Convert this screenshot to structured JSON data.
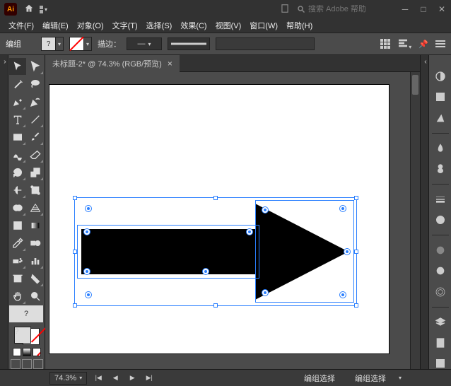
{
  "app": {
    "logo_text": "Ai"
  },
  "search": {
    "placeholder": "搜索 Adobe 帮助"
  },
  "menus": {
    "file": "文件(F)",
    "edit": "编辑(E)",
    "object": "对象(O)",
    "type": "文字(T)",
    "select": "选择(S)",
    "effect": "效果(C)",
    "view": "视图(V)",
    "window": "窗口(W)",
    "help": "帮助(H)"
  },
  "control": {
    "mode_label": "编组",
    "fill_q": "?",
    "stroke_label": "描边：",
    "stroke_dash": "—"
  },
  "tab": {
    "title": "未标题-2* @ 74.3% (RGB/预览)"
  },
  "tool_unknown": "?",
  "status": {
    "zoom": "74.3%",
    "selection_label": "编组选择",
    "tool_label": "编组选择"
  }
}
